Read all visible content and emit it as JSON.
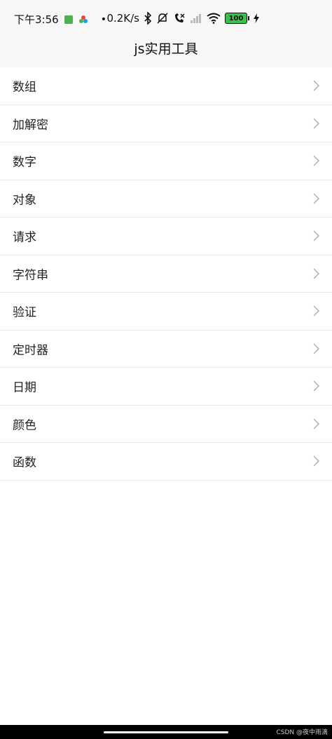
{
  "status_bar": {
    "time": "下午3:56",
    "network_speed": "0.2K/s",
    "battery_level": "100",
    "icons": [
      "gallery-icon",
      "app-icon",
      "bluetooth-icon",
      "mute-icon",
      "call-icon",
      "signal-icon",
      "wifi-icon",
      "battery-icon",
      "charging-icon"
    ]
  },
  "header": {
    "title": "js实用工具"
  },
  "menu": {
    "items": [
      {
        "label": "数组"
      },
      {
        "label": "加解密"
      },
      {
        "label": "数字"
      },
      {
        "label": "对象"
      },
      {
        "label": "请求"
      },
      {
        "label": "字符串"
      },
      {
        "label": "验证"
      },
      {
        "label": "定时器"
      },
      {
        "label": "日期"
      },
      {
        "label": "颜色"
      },
      {
        "label": "函数"
      }
    ]
  },
  "footer": {
    "watermark": "CSDN @夜中雨滴"
  },
  "colors": {
    "background": "#ffffff",
    "header_background": "#f7f7f7",
    "divider": "#e9e9e9",
    "chevron": "#b0b0b0",
    "battery_fill": "#39c24a"
  }
}
